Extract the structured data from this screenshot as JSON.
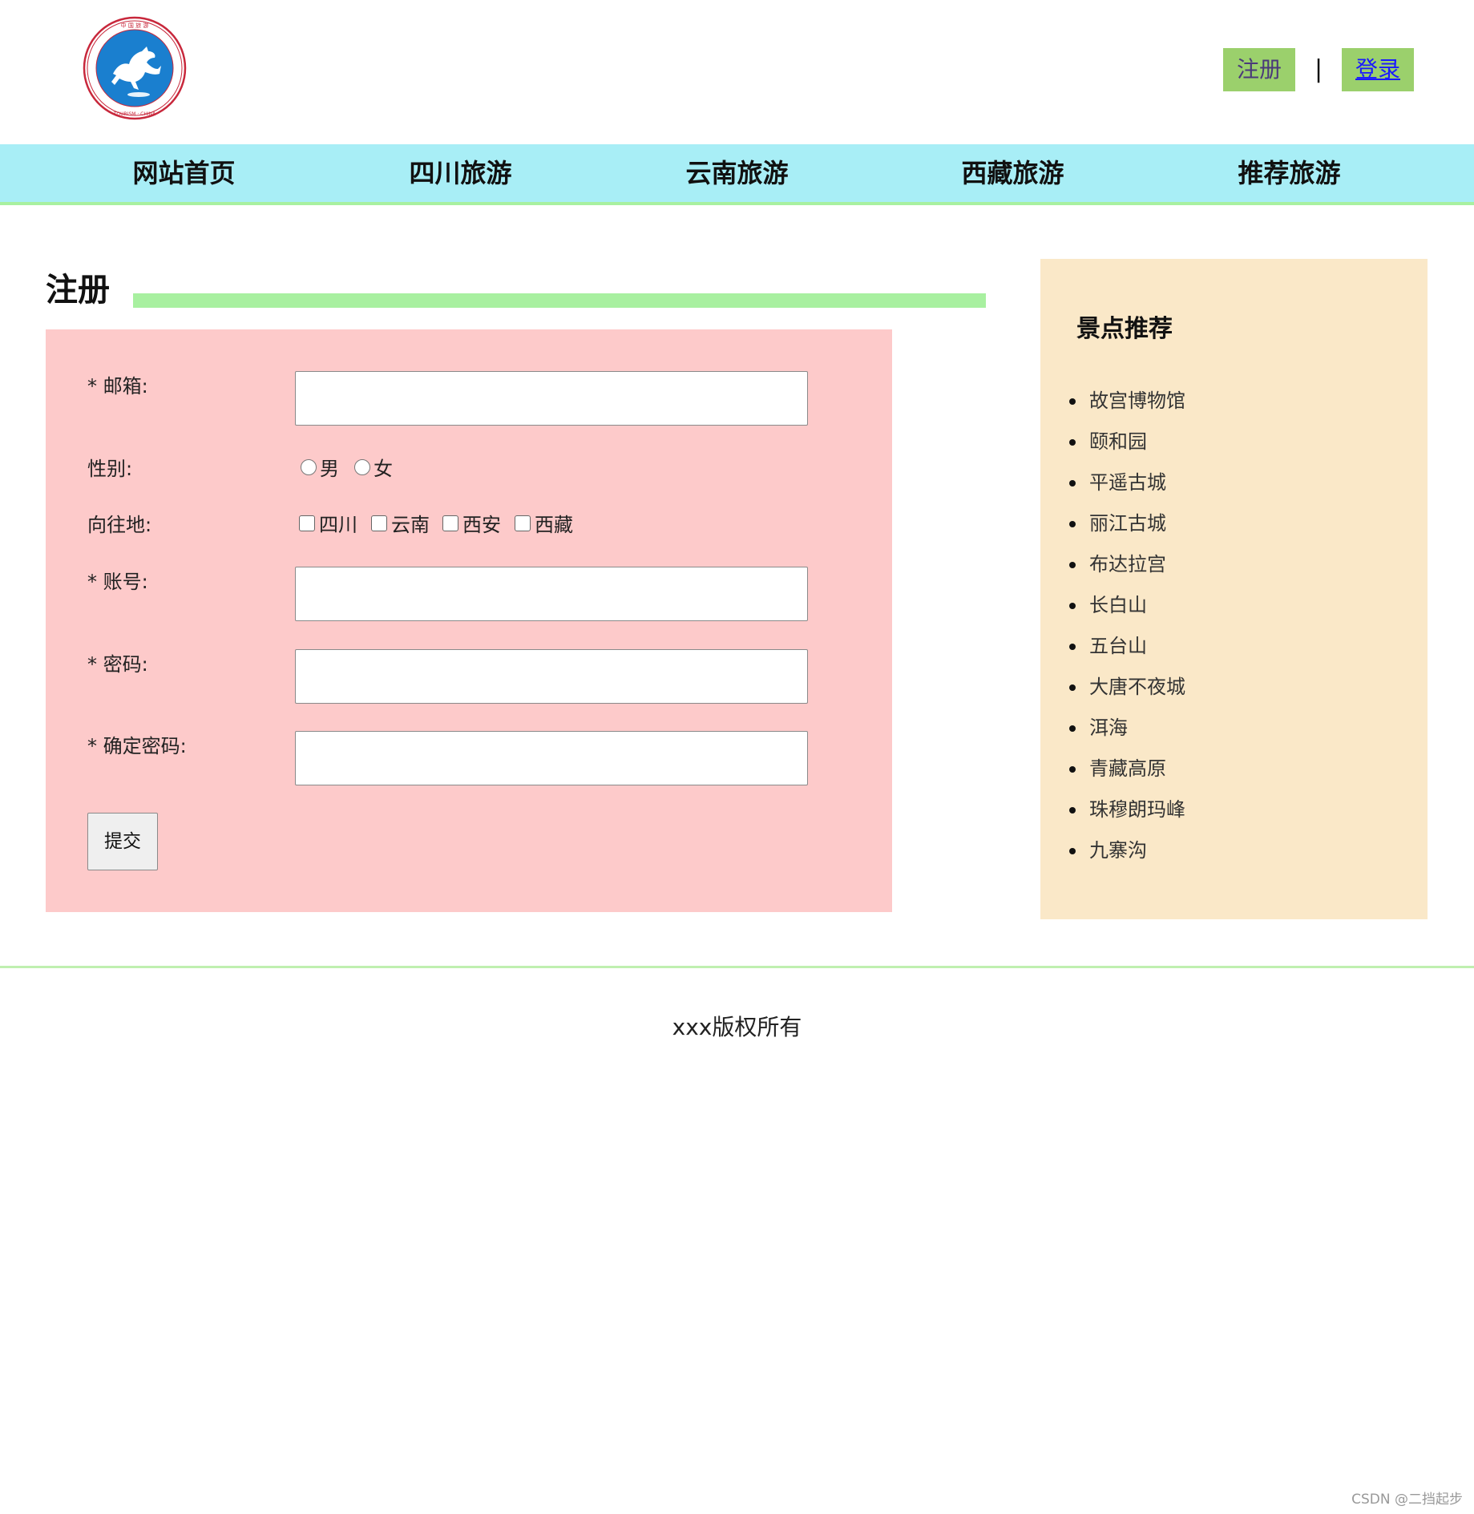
{
  "header": {
    "logo_text": "中国旅游 CHINA TOURISM",
    "register_label": "注册",
    "separator": "|",
    "login_label": "登录"
  },
  "nav": {
    "items": [
      "网站首页",
      "四川旅游",
      "云南旅游",
      "西藏旅游",
      "推荐旅游"
    ]
  },
  "form": {
    "title": "注册",
    "email_label": "* 邮箱:",
    "email_value": "",
    "gender_label": "性别:",
    "gender_options": [
      "男",
      "女"
    ],
    "destination_label": "向往地:",
    "destination_options": [
      "四川",
      "云南",
      "西安",
      "西藏"
    ],
    "account_label": "* 账号:",
    "account_value": "",
    "password_label": "* 密码:",
    "password_value": "",
    "confirm_label": "* 确定密码:",
    "confirm_value": "",
    "submit_label": "提交"
  },
  "sidebar": {
    "title": "景点推荐",
    "items": [
      "故宫博物馆",
      "颐和园",
      "平遥古城",
      "丽江古城",
      "布达拉宫",
      "长白山",
      "五台山",
      "大唐不夜城",
      "洱海",
      "青藏高原",
      "珠穆朗玛峰",
      "九寨沟"
    ]
  },
  "footer": {
    "copyright": "xxx版权所有"
  },
  "watermark": "CSDN @二挡起步",
  "colors": {
    "nav_bg": "#a8eef6",
    "accent_green": "#a8f0a0",
    "auth_button_bg": "#9bd06c",
    "form_bg": "#fdcaca",
    "sidebar_bg": "#fae8c8",
    "logo_blue": "#1a7fcf",
    "logo_ring": "#c8283c"
  }
}
